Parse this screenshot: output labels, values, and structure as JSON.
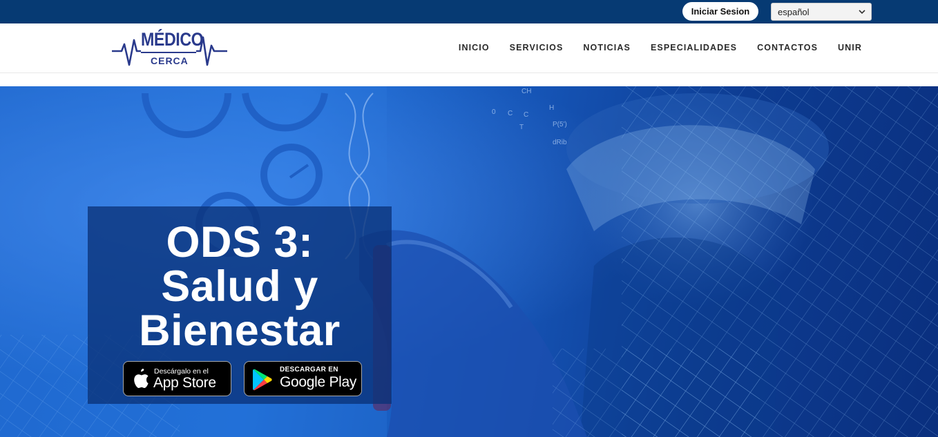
{
  "topbar": {
    "login_label": "Iniciar Sesion",
    "language": {
      "selected": "español"
    },
    "background": "#063a73"
  },
  "header": {
    "logo": {
      "top": "MÉDICO",
      "bottom": "CERCA"
    },
    "nav": [
      {
        "label": "INICIO"
      },
      {
        "label": "SERVICIOS"
      },
      {
        "label": "NOTICIAS"
      },
      {
        "label": "ESPECIALIDADES"
      },
      {
        "label": "CONTACTOS"
      },
      {
        "label": "UNIR"
      }
    ]
  },
  "hero": {
    "title_line1": "ODS 3:",
    "title_line2": "Salud y",
    "title_line3": "Bienestar",
    "app_store": {
      "small": "Descárgalo en el",
      "big": "App Store"
    },
    "google_play": {
      "small": "DESCARGAR EN",
      "big": "Google Play"
    },
    "accent": "#1a62c9"
  },
  "icons": [
    "chevron-down-icon",
    "heartbeat-logo-icon",
    "apple-icon",
    "google-play-icon"
  ]
}
